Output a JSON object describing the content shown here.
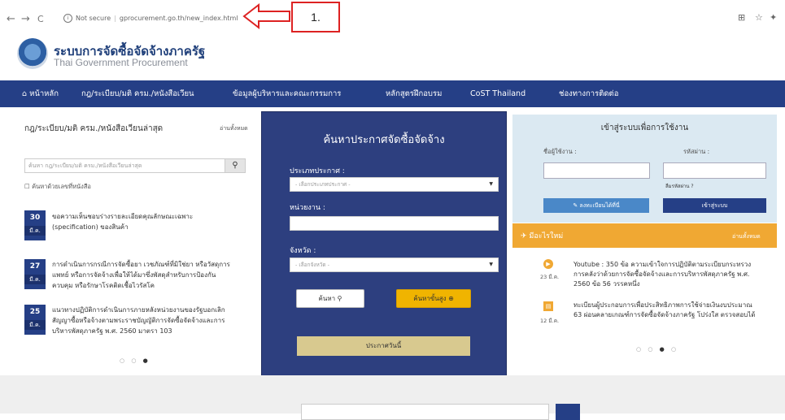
{
  "browser": {
    "back": "←",
    "forward": "→",
    "reload": "C",
    "security": "Not secure",
    "url": "gprocurement.go.th/new_index.html",
    "annotation": "1."
  },
  "header": {
    "title": "ระบบการจัดซื้อจัดจ้างภาครัฐ",
    "subtitle": "Thai Government Procurement"
  },
  "nav": {
    "items": [
      "หน้าหลัก",
      "กฎ/ระเบียบ/มติ ครม./หนังสือเวียน",
      "ข้อมูลผู้บริหารและคณะกรรมการ",
      "หลักสูตรฝึกอบรม",
      "CoST Thailand",
      "ช่องทางการติดต่อ"
    ]
  },
  "news": {
    "heading": "กฎ/ระเบียบ/มติ ครม./หนังสือเวียนล่าสุด",
    "read_all": "อ่านทั้งหมด",
    "search_placeholder": "ค้นหา กฎ/ระเบียบ/มติ ครม./หนังสือเวียนล่าสุด",
    "search_by_docno": "ค้นหาด้วยเลขที่หนังสือ",
    "items": [
      {
        "day": "30",
        "month": "มี.ค.",
        "text": "ขอความเห็นชอบร่างรายละเอียดคุณลักษณะเฉพาะ (specification) ของสินค้า"
      },
      {
        "day": "27",
        "month": "มี.ค.",
        "text": "การดำเนินการกรณีการจัดซื้อยา เวชภัณฑ์ที่มิใช่ยา หรือวัสดุการแพทย์ หรือการจัดจ้างเพื่อให้ได้มาซึ่งพัสดุสำหรับการป้องกัน ควบคุม หรือรักษาโรคติดเชื้อไวรัสโค"
      },
      {
        "day": "25",
        "month": "มี.ค.",
        "text": "แนวทางปฏิบัติการดำเนินการภายหลังหน่วยงานของรัฐบอกเลิกสัญญาซื้อหรือจ้างตามพระราชบัญญัติการจัดซื้อจัดจ้างและการบริหารพัสดุภาครัฐ พ.ศ. 2560 มาตรา 103"
      }
    ]
  },
  "search_panel": {
    "title": "ค้นหาประกาศจัดซื้อจัดจ้าง",
    "announce_type_label": "ประเภทประกาศ :",
    "announce_type_value": "- เลือกประเภทประกาศ -",
    "agency_label": "หน่วยงาน :",
    "province_label": "จังหวัด :",
    "province_value": "- เลือกจังหวัด -",
    "search_button": "ค้นหา",
    "advanced_button": "ค้นหาขั้นสูง",
    "today_button": "ประกาศวันนี้"
  },
  "login": {
    "title": "เข้าสู่ระบบเพื่อการใช้งาน",
    "username_label": "ชื่อผู้ใช้งาน :",
    "password_label": "รหัสผ่าน :",
    "forgot": "ลืมรหัสผ่าน ?",
    "register_button": "ลงทะเบียนได้ที่นี่",
    "login_button": "เข้าสู่ระบบ"
  },
  "whats_new": {
    "label": "มีอะไรใหม่",
    "read_all": "อ่านทั้งหมด",
    "items": [
      {
        "date": "23 มี.ค.",
        "text": "Youtube : 350 ข้อ ความเข้าใจการปฏิบัติตามระเบียบกระทรวงการคลังว่าด้วยการจัดซื้อจัดจ้างและการบริหารพัสดุภาครัฐ พ.ศ. 2560 ข้อ 56 วรรคหนึ่ง"
      },
      {
        "date": "12 มี.ค.",
        "text": "ทะเบียนผู้ประกอบการเพื่อประสิทธิภาพการใช้จ่ายเงินงบประมาณ 63 ผ่อนคลายเกณฑ์การจัดซื้อจัดจ้างภาครัฐ โปร่งใส ตรวจสอบได้"
      }
    ]
  },
  "colors": {
    "nav": "#253f86",
    "panel": "#2d3f7f",
    "accent": "#f0a833",
    "advanced": "#f0b400"
  }
}
